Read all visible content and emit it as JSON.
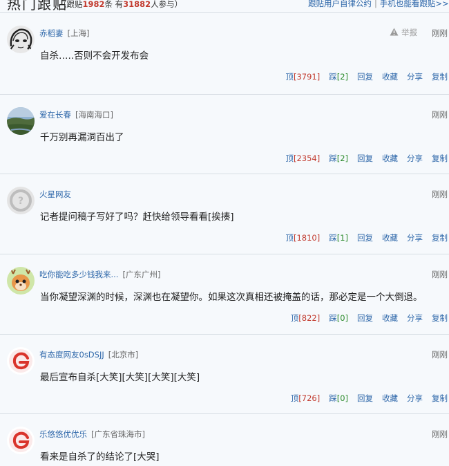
{
  "header": {
    "title": "热门跟贴",
    "stats_prefix": "（跟贴",
    "post_count": "1982",
    "stats_mid": "条  有",
    "user_count": "31882",
    "stats_suffix": "人参与）",
    "link_rules": "跟贴用户自律公约",
    "link_mobile": "手机也能看跟贴>>"
  },
  "labels": {
    "report": "举报",
    "up": "顶",
    "down": "踩",
    "reply": "回复",
    "collect": "收藏",
    "share": "分享",
    "copy": "复制"
  },
  "comments": [
    {
      "user": "赤稻妻",
      "location": "[上海]",
      "time": "刚刚",
      "content": "自杀…..否则不会开发布会",
      "up": "[3791]",
      "down": "[2]",
      "avatar": "sketch-face-icon",
      "has_report": true
    },
    {
      "user": "爱在长春",
      "location": "[海南海口]",
      "time": "刚刚",
      "content": "千万别再漏洞百出了",
      "up": "[2354]",
      "down": "[2]",
      "avatar": "landscape-photo-icon",
      "has_report": false
    },
    {
      "user": "火星网友",
      "location": "",
      "time": "刚刚",
      "content": "记者提问稿子写好了吗？赶快给领导看看[挨揍]",
      "up": "[1810]",
      "down": "[1]",
      "avatar": "default-user-icon",
      "has_report": false
    },
    {
      "user": "吃你能吃多少钱我来...",
      "location": "[广东广州]",
      "time": "刚刚",
      "content": "当你凝望深渊的时候，深渊也在凝望你。如果这次真相还被掩盖的话，那必定是一个大倒退。",
      "up": "[822]",
      "down": "[0]",
      "avatar": "cartoon-deer-icon",
      "has_report": false
    },
    {
      "user": "有态度网友0sDSJJ",
      "location": "[北京市]",
      "time": "刚刚",
      "content": "最后宣布自杀[大笑][大笑][大笑][大笑]",
      "up": "[726]",
      "down": "[0]",
      "avatar": "netease-logo-icon",
      "has_report": false
    },
    {
      "user": "乐悠悠优优乐",
      "location": "[广东省珠海市]",
      "time": "刚刚",
      "content": "看来是自杀了的结论了[大哭]",
      "up": "",
      "down": "",
      "avatar": "netease-logo-icon",
      "has_report": false
    }
  ]
}
